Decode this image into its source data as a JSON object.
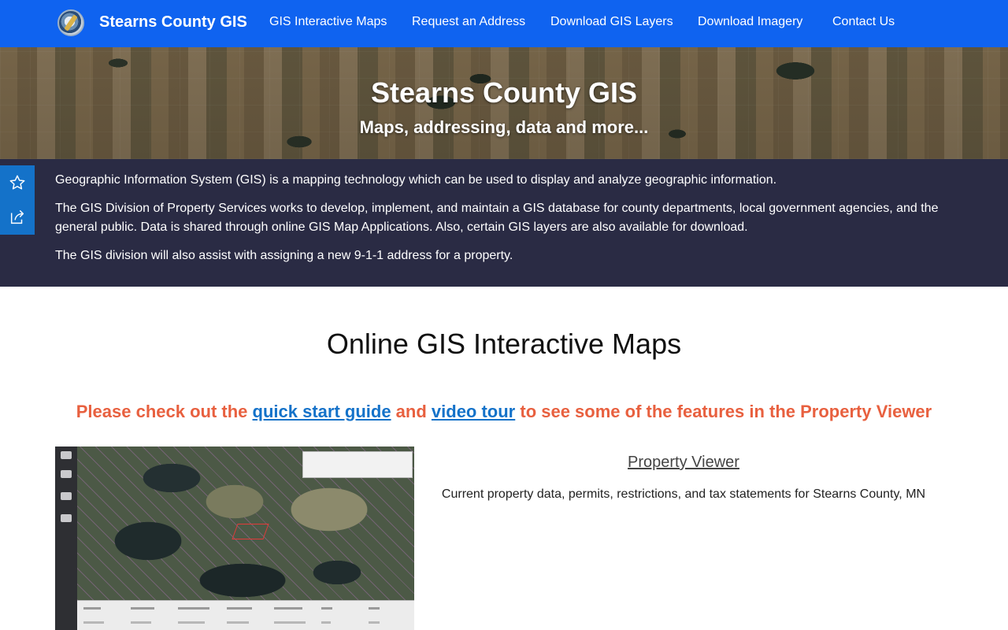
{
  "header": {
    "site_title": "Stearns County GIS",
    "nav": [
      "GIS Interactive Maps",
      "Request an Address",
      "Download GIS Layers",
      "Download Imagery",
      "Contact Us"
    ]
  },
  "hero": {
    "title": "Stearns County GIS",
    "subtitle": "Maps, addressing, data and more..."
  },
  "intro": {
    "p1": "Geographic Information System (GIS) is a mapping technology which can be used to display and analyze geographic information.",
    "p2": "The GIS Division of Property Services works to develop, implement, and maintain a GIS database for county departments, local government agencies, and the general public.  Data is shared through online GIS Map Applications.  Also, certain GIS layers are also available for download.",
    "p3": "The GIS division will also assist with assigning a new 9-1-1 address for a property."
  },
  "side_tools": {
    "favorite_icon": "star-icon",
    "share_icon": "share-icon"
  },
  "section": {
    "title": "Online GIS Interactive Maps",
    "promo_before": "Please check out the ",
    "promo_link1": "quick start guide",
    "promo_mid": " and ",
    "promo_link2": "video tour",
    "promo_after": " to see some of the features in the Property Viewer"
  },
  "property_viewer": {
    "title": "Property Viewer",
    "description": "Current property data, permits, restrictions, and tax statements for Stearns County, MN"
  },
  "colors": {
    "nav_bg": "#0f63f0",
    "intro_bg": "#2a2b44",
    "promo_text": "#e8603f",
    "link": "#1472c9"
  }
}
